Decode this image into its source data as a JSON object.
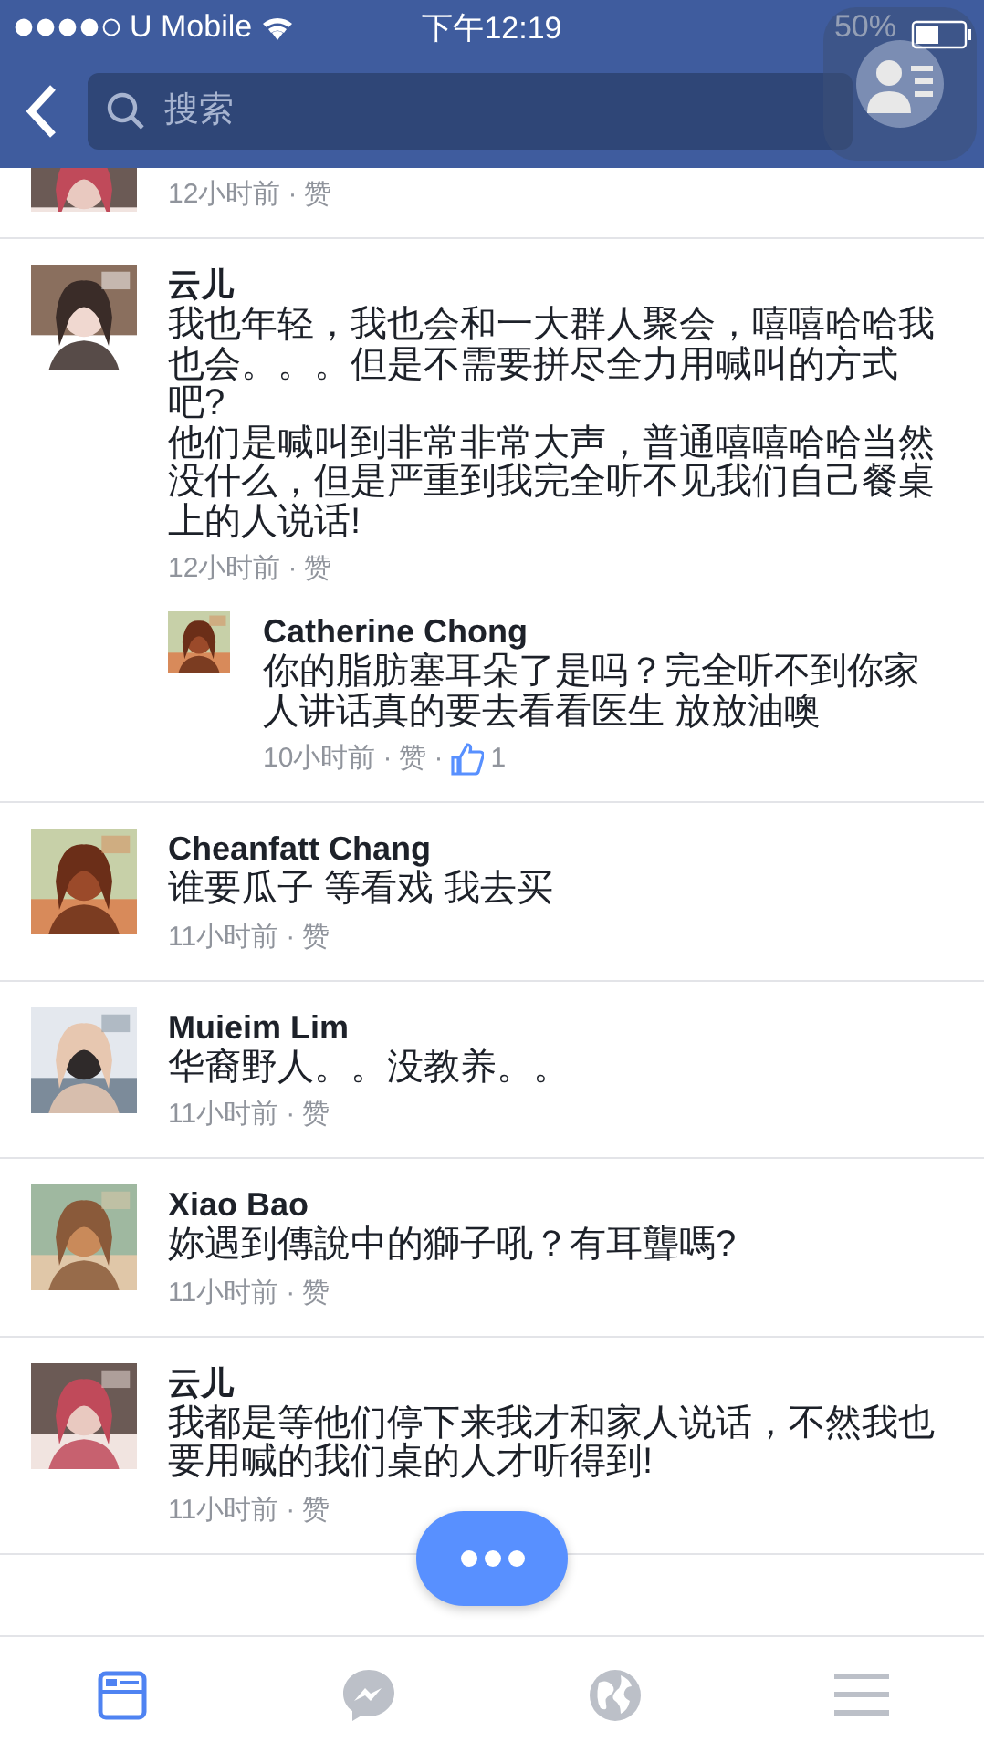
{
  "status_bar": {
    "carrier": "U Mobile",
    "time": "下午12:19",
    "battery": "50%"
  },
  "nav": {
    "search": {
      "placeholder": "搜索"
    }
  },
  "comments": [
    {
      "kind": "partial",
      "time": "12小时前",
      "sep": "·",
      "like": "赞"
    },
    {
      "kind": "comment",
      "name": "云儿",
      "text": "我也年轻，我也会和一大群人聚会，嘻嘻哈哈我也会。。。但是不需要拼尽全力用喊叫的方式吧?\n他们是喊叫到非常非常大声，普通嘻嘻哈哈当然没什么，但是严重到我完全听不见我们自己餐桌上的人说话!",
      "time": "12小时前",
      "sep": "·",
      "like": "赞",
      "replies": [
        {
          "name": "Catherine Chong",
          "text": "你的脂肪塞耳朵了是吗？完全听不到你家人讲话真的要去看看医生 放放油噢",
          "time": "10小时前",
          "sep": "·",
          "like": "赞",
          "likes_sep": "·",
          "likes": "1"
        }
      ]
    },
    {
      "kind": "comment",
      "name": "Cheanfatt Chang",
      "text": "谁要瓜子 等看戏 我去买",
      "time": "11小时前",
      "sep": "·",
      "like": "赞"
    },
    {
      "kind": "comment",
      "name": "Muieim Lim",
      "text": "华裔野人。。没教养。。",
      "time": "11小时前",
      "sep": "·",
      "like": "赞"
    },
    {
      "kind": "comment",
      "name": "Xiao Bao",
      "text": "妳遇到傳說中的獅子吼？有耳聾嗎?",
      "time": "11小时前",
      "sep": "·",
      "like": "赞"
    },
    {
      "kind": "comment",
      "name": "云儿",
      "text": "我都是等他们停下来我才和家人说话，不然我也要用喊的我们桌的人才听得到!",
      "time": "11小时前",
      "sep": "·",
      "like": "赞"
    }
  ],
  "tabs": [
    {
      "kind": "feed",
      "selected": true
    },
    {
      "kind": "messenger",
      "selected": false
    },
    {
      "kind": "globe",
      "selected": false
    },
    {
      "kind": "menu",
      "selected": false
    }
  ]
}
